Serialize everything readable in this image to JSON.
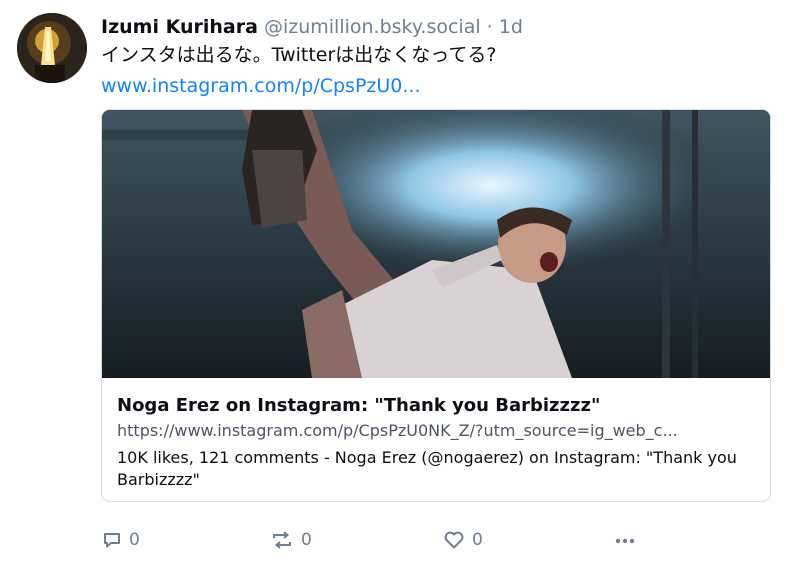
{
  "post": {
    "author": {
      "display_name": "Izumi Kurihara",
      "handle": "@izumillion.bsky.social",
      "separator": "·",
      "time": "1d"
    },
    "text": "インスタは出るな。Twitterは出なくなってる?",
    "link_text": "www.instagram.com/p/CpsPzU0..."
  },
  "embed": {
    "title": "Noga Erez on Instagram: \"Thank you Barbizzzz\"",
    "url": "https://www.instagram.com/p/CpsPzU0NK_Z/?utm_source=ig_web_c...",
    "description": "10K likes, 121 comments - Noga Erez (@nogaerez) on Instagram: \"Thank you Barbizzzz\""
  },
  "actions": {
    "reply_count": "0",
    "repost_count": "0",
    "like_count": "0"
  },
  "icons": {
    "reply": "reply-icon",
    "repost": "repost-icon",
    "like": "heart-icon",
    "more": "more-options-icon"
  },
  "colors": {
    "link": "#1083fe",
    "muted": "#6f7f8f",
    "text": "#0b0f14",
    "border": "#d4dbe2"
  }
}
